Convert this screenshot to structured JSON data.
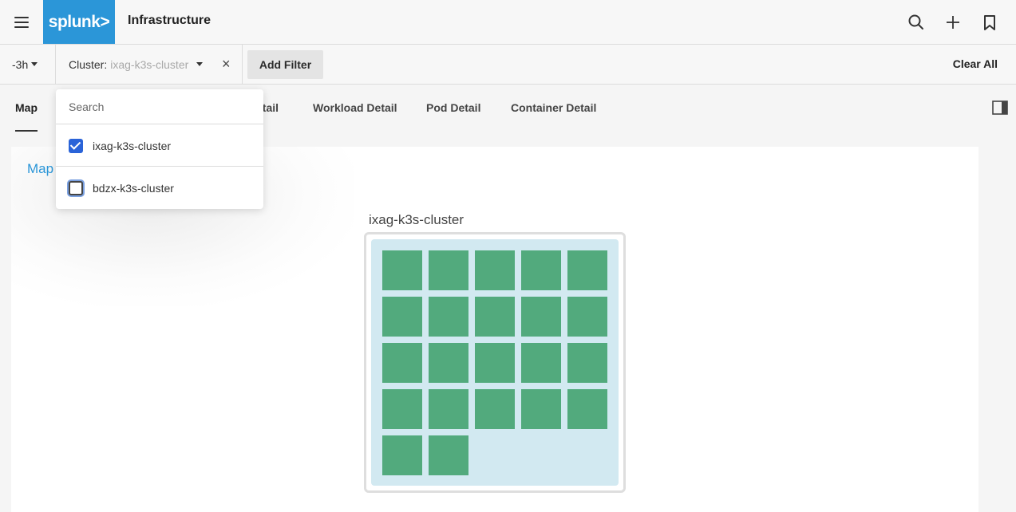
{
  "header": {
    "logo_text": "splunk>",
    "title": "Infrastructure",
    "icons": [
      "menu-icon",
      "search-icon",
      "plus-icon",
      "bookmark-icon"
    ]
  },
  "filters": {
    "time_range": "-3h",
    "cluster_label": "Cluster:",
    "cluster_value": "ixag-k3s-cluster",
    "close_symbol": "×",
    "add_filter_label": "Add Filter",
    "clear_all_label": "Clear All"
  },
  "tabs": [
    {
      "label": "Map",
      "active": true
    },
    {
      "label": "etail",
      "active": false
    },
    {
      "label": "Workload Detail",
      "active": false
    },
    {
      "label": "Pod Detail",
      "active": false
    },
    {
      "label": "Container Detail",
      "active": false
    }
  ],
  "dropdown": {
    "search_placeholder": "Search",
    "options": [
      {
        "label": "ixag-k3s-cluster",
        "checked": true
      },
      {
        "label": "bdzx-k3s-cluster",
        "checked": false
      }
    ]
  },
  "main": {
    "map_link": "Map",
    "cluster_name": "ixag-k3s-cluster",
    "node_count": 22,
    "node_color": "#52aa7d",
    "cluster_bg_color": "#d2e9f1"
  },
  "colors": {
    "brand": "#2b96d8",
    "checkbox": "#2a63d8"
  }
}
